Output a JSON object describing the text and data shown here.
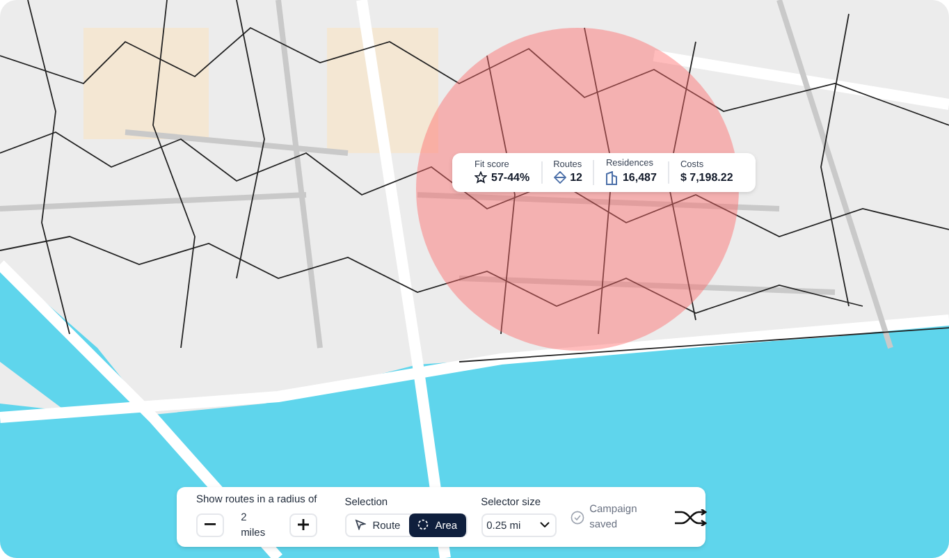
{
  "summary": {
    "stats": [
      {
        "kind": "fit",
        "label": "Fit score",
        "value": "57-44%"
      },
      {
        "kind": "routes",
        "label": "Routes",
        "value": "12"
      },
      {
        "kind": "residences",
        "label": "Residences",
        "value": "16,487"
      },
      {
        "kind": "costs",
        "label": "Costs",
        "value": "$ 7,198.22"
      }
    ]
  },
  "toolbar": {
    "radius": {
      "label": "Show routes in a radius of",
      "value": "2 miles"
    },
    "selection": {
      "label": "Selection",
      "options": [
        {
          "kind": "route",
          "label": "Route",
          "selected": false
        },
        {
          "kind": "area",
          "label": "Area",
          "selected": true
        }
      ]
    },
    "selector_size": {
      "label": "Selector size",
      "value": "0.25 mi"
    },
    "status": {
      "text": "Campaign saved"
    }
  }
}
